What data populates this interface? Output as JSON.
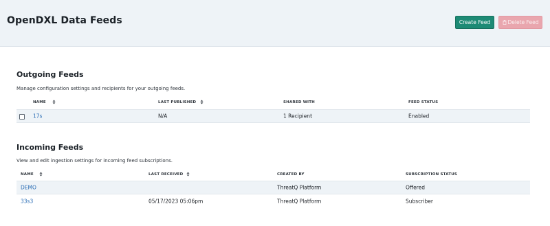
{
  "header": {
    "title": "OpenDXL Data Feeds",
    "create_label": "Create Feed",
    "delete_label": "Delete Feed"
  },
  "outgoing": {
    "title": "Outgoing Feeds",
    "description": "Manage configuration settings and recipients for your outgoing feeds.",
    "columns": [
      "NAME",
      "LAST PUBLISHED",
      "SHARED WITH",
      "FEED STATUS"
    ],
    "rows": [
      {
        "name": "17s",
        "last_published": "N/A",
        "shared_with": "1 Recipient",
        "status": "Enabled"
      }
    ]
  },
  "incoming": {
    "title": "Incoming Feeds",
    "description": "View and edit ingestion settings for incoming feed subscriptions.",
    "columns": [
      "NAME",
      "LAST RECEIVED",
      "CREATED BY",
      "SUBSCRIPTION STATUS"
    ],
    "rows": [
      {
        "name": "DEMO",
        "last_received": "",
        "created_by": "ThreatQ Platform",
        "status": "Offered"
      },
      {
        "name": "33s3",
        "last_received": "05/17/2023 05:06pm",
        "created_by": "ThreatQ Platform",
        "status": "Subscriber"
      }
    ]
  },
  "colors": {
    "primary": "#1d8a75",
    "danger_disabled": "#e9a6ae",
    "link": "#2a6db5",
    "header_bg": "#eef3f7"
  }
}
